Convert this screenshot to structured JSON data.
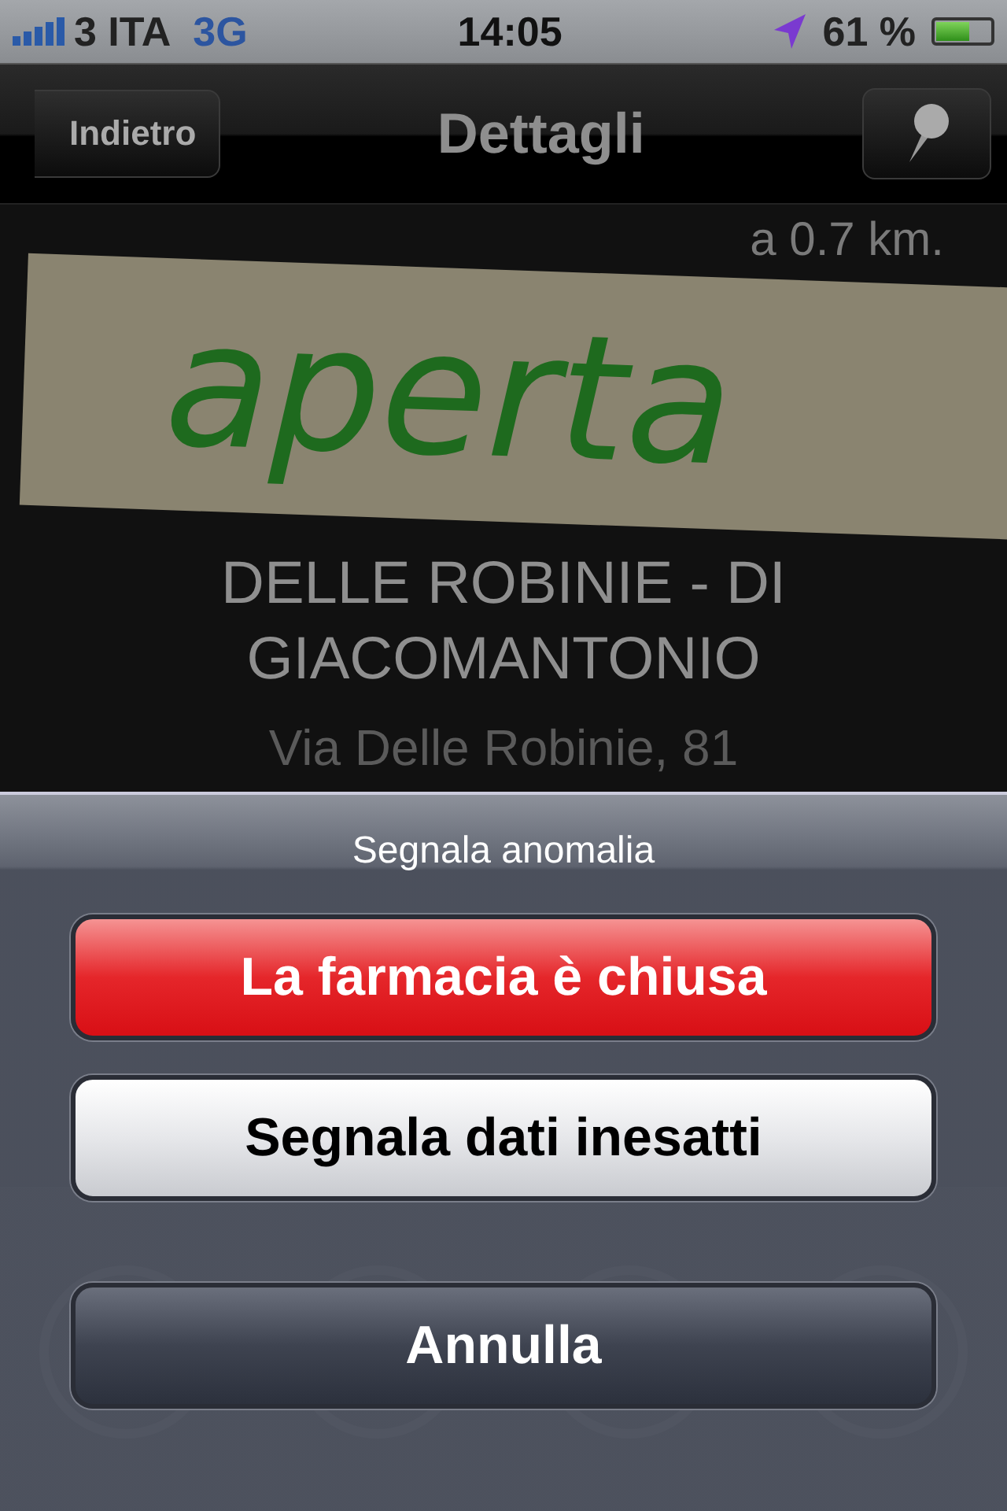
{
  "status_bar": {
    "carrier": "3 ITA",
    "network": "3G",
    "time": "14:05",
    "battery": "61 %"
  },
  "nav_bar": {
    "back": "Indietro",
    "title": "Dettagli"
  },
  "details": {
    "distance": "a 0.7 km.",
    "status_tag": "aperta",
    "name": "DELLE ROBINIE - DI GIACOMANTONIO",
    "street": "Via Delle Robinie, 81"
  },
  "action_sheet": {
    "title": "Segnala anomalia",
    "buttons": [
      {
        "label": "La farmacia è chiusa",
        "kind": "destructive"
      },
      {
        "label": "Segnala dati inesatti",
        "kind": "default"
      },
      {
        "label": "Annulla",
        "kind": "cancel"
      }
    ]
  }
}
